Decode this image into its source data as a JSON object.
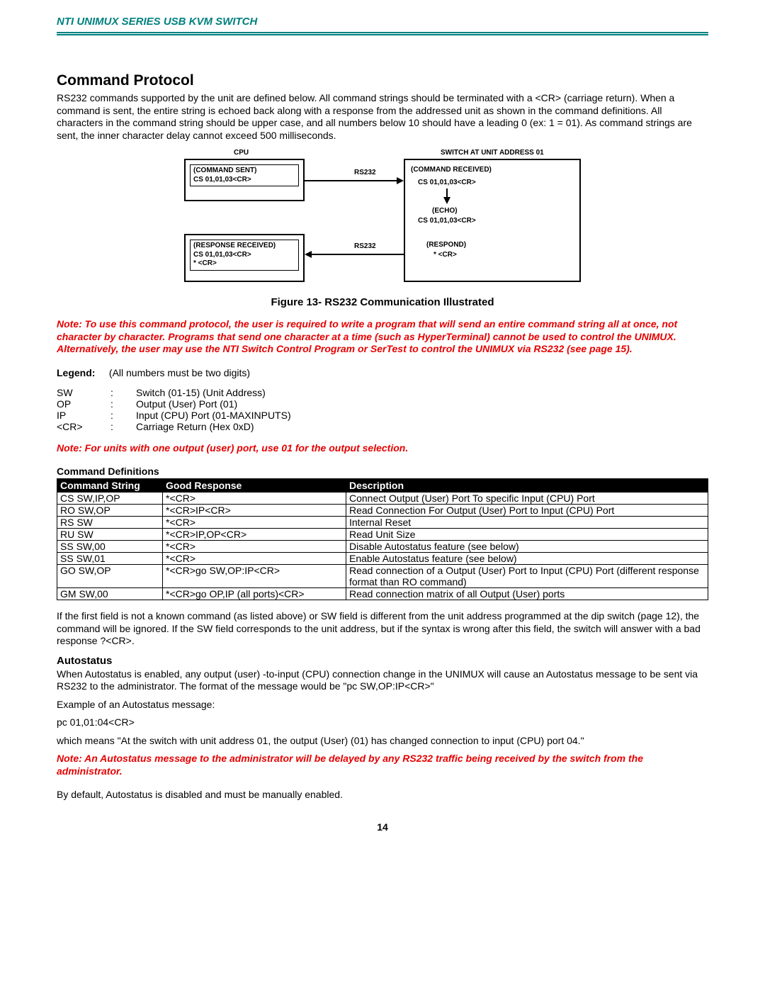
{
  "header": {
    "title": "NTI UNIMUX SERIES USB KVM SWITCH"
  },
  "section": {
    "title": "Command Protocol"
  },
  "intro": "RS232 commands supported by the unit are defined below. All command strings should be terminated with a <CR> (carriage return). When a command is sent, the entire string is echoed back along with a response from the addressed unit as shown in the command definitions.  All characters in the command string should be upper case, and all numbers below 10 should have a leading 0 (ex: 1 = 01).   As command strings are sent, the inner character delay cannot exceed 500 milliseconds.",
  "diagram": {
    "cpu_label": "CPU",
    "switch_label": "SWITCH AT UNIT ADDRESS 01",
    "rs232a": "RS232",
    "rs232b": "RS232",
    "command_sent_title": "(COMMAND SENT)",
    "command_sent_body": "CS 01,01,03<CR>",
    "response_received_title": "(RESPONSE RECEIVED)",
    "response_received_body1": "CS 01,01,03<CR>",
    "response_received_body2": "* <CR>",
    "command_received_title": "(COMMAND RECEIVED)",
    "command_received_body": "CS 01,01,03<CR>",
    "echo_title": "(ECHO)",
    "echo_body": "CS 01,01,03<CR>",
    "respond_title": "(RESPOND)",
    "respond_body": "* <CR>"
  },
  "figcaption": "Figure 13- RS232 Communication Illustrated",
  "note1": "Note: To use this command protocol, the user is required to write a program that will send an entire command string all at once, not character by character.  Programs that send one character at a time (such as HyperTerminal) cannot be used to control the UNIMUX.   Alternatively, the user may use the NTI Switch Control Program or SerTest to control the UNIMUX via RS232 (see page 15).",
  "legend": {
    "label": "Legend",
    "intro": "(All numbers must be two digits)",
    "rows": [
      {
        "k": "SW",
        "v": "Switch (01-15) (Unit Address)"
      },
      {
        "k": "OP",
        "v": "Output (User) Port (01)"
      },
      {
        "k": "IP",
        "v": "Input (CPU) Port (01-MAXINPUTS)"
      },
      {
        "k": "<CR>",
        "v": "Carriage Return (Hex 0xD)"
      }
    ]
  },
  "note2": "Note: For units with one output (user) port, use 01 for the output selection.",
  "cmddef": {
    "title": "Command Definitions",
    "headers": [
      "Command String",
      "Good Response",
      "Description"
    ],
    "rows": [
      {
        "c": "CS SW,IP,OP",
        "r": "*<CR>",
        "d": "Connect Output (User) Port  To specific Input (CPU) Port"
      },
      {
        "c": "RO SW,OP",
        "r": "*<CR>IP<CR>",
        "d": "Read Connection For Output  (User) Port to Input (CPU) Port"
      },
      {
        "c": "RS SW",
        "r": "*<CR>",
        "d": "Internal Reset"
      },
      {
        "c": "RU SW",
        "r": "*<CR>IP,OP<CR>",
        "d": "Read Unit Size"
      },
      {
        "c": "SS SW,00",
        "r": "*<CR>",
        "d": "Disable Autostatus feature (see below)"
      },
      {
        "c": "SS SW,01",
        "r": "*<CR>",
        "d": "Enable Autostatus feature (see below)"
      },
      {
        "c": "GO SW,OP",
        "r": "*<CR>go SW,OP:IP<CR>",
        "d": "Read connection of a Output (User) Port  to Input (CPU) Port (different response format than RO command)"
      },
      {
        "c": "GM SW,00",
        "r": "*<CR>go OP,IP (all ports)<CR>",
        "d": "Read connection matrix of all Output (User) ports"
      }
    ]
  },
  "after_table": "If the first field is not a known command (as listed above) or SW field is different from the unit address programmed at the dip switch (page 12), the command will be ignored.  If the SW field corresponds to the unit address, but if the syntax is wrong after this field, the switch will answer with a bad response  ?<CR>.",
  "auto": {
    "title": "Autostatus",
    "p1": "When Autostatus is enabled, any output (user) -to-input (CPU) connection change in the UNIMUX will cause an Autostatus message to be sent via RS232 to the administrator.    The format of the message would be \"pc SW,OP:IP<CR>\"",
    "p2": "Example of an Autostatus message:",
    "example": "pc 01,01:04<CR>",
    "p3": "which means  \"At the switch with unit address 01,  the output (User) (01) has changed connection to input (CPU) port 04.\""
  },
  "note3": "Note:  An Autostatus message to the administrator will be delayed by any RS232 traffic being received by the switch from the administrator.",
  "closing": "By default,  Autostatus is disabled and must be manually enabled.",
  "page_number": "14"
}
